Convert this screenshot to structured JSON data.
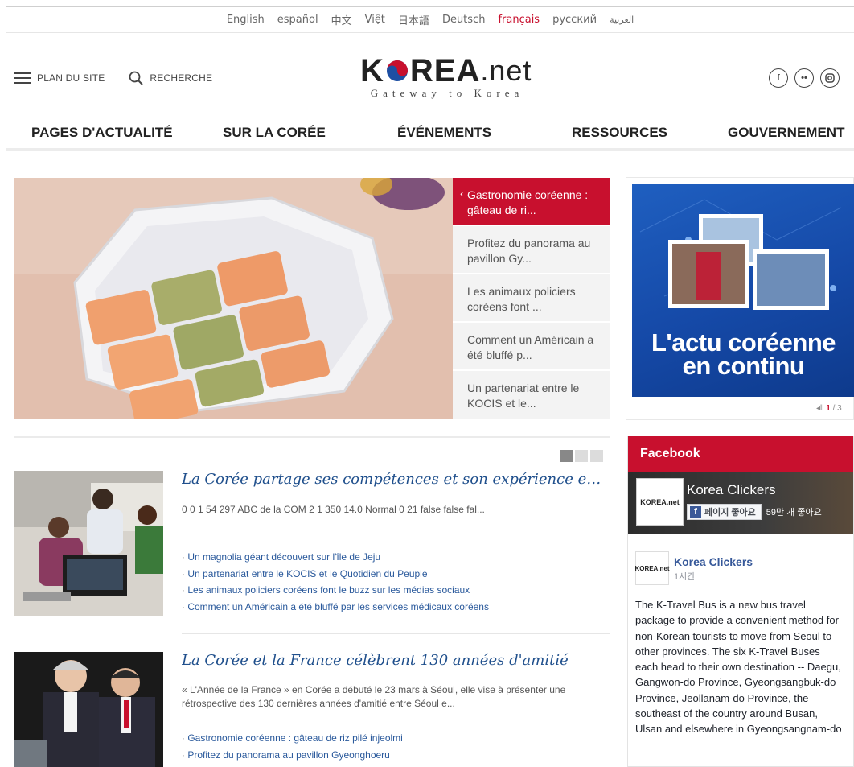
{
  "languages": [
    {
      "label": "English",
      "active": false
    },
    {
      "label": "español",
      "active": false
    },
    {
      "label": "中文",
      "active": false
    },
    {
      "label": "Việt",
      "active": false
    },
    {
      "label": "日本語",
      "active": false
    },
    {
      "label": "Deutsch",
      "active": false
    },
    {
      "label": "français",
      "active": true
    },
    {
      "label": "русский",
      "active": false
    },
    {
      "label": "العربية",
      "active": false
    }
  ],
  "header": {
    "sitemap_label": "PLAN DU SITE",
    "search_label": "RECHERCHE",
    "logo_text_left": "K",
    "logo_text_right": "REA",
    "logo_net": ".net",
    "logo_tagline": "Gateway to Korea",
    "social_icons": [
      "facebook-icon",
      "flickr-icon",
      "instagram-icon"
    ]
  },
  "nav": [
    "PAGES D'ACTUALITÉ",
    "SUR LA CORÉE",
    "ÉVÉNEMENTS",
    "RESSOURCES",
    "GOUVERNEMENT"
  ],
  "slider": {
    "items": [
      {
        "label": "Gastronomie coréenne : gâteau de ri...",
        "active": true
      },
      {
        "label": "Profitez du panorama au pavillon Gy...",
        "active": false
      },
      {
        "label": "Les animaux policiers coréens font ...",
        "active": false
      },
      {
        "label": "Comment un Américain a été bluffé p...",
        "active": false
      },
      {
        "label": "Un partenariat entre le KOCIS et le...",
        "active": false
      }
    ]
  },
  "banner": {
    "title_line1": "L'actu coréenne",
    "title_line2": "en continu",
    "pager_current": "1",
    "pager_rest": " / 3",
    "pager_prefix": "◂ll "
  },
  "articles": [
    {
      "title": "La Corée partage ses compétences et son expérience en ma...",
      "desc": "0 0 1 54 297 ABC de la COM 2 1 350 14.0 Normal 0 21 false false fal...",
      "links": [
        "Un magnolia géant découvert sur l'île de Jeju",
        "Un partenariat entre le KOCIS et le Quotidien du Peuple",
        "Les animaux policiers coréens font le buzz sur les médias sociaux",
        "Comment un Américain a été bluffé par les services médicaux coréens"
      ]
    },
    {
      "title": "La Corée et la France célèbrent 130 années d'amitié",
      "desc": "« L'Année de la France » en Corée a débuté le 23 mars à Séoul, elle vise à présenter une rétrospective des 130 dernières années d'amitié entre Séoul e...",
      "links": [
        "Gastronomie coréenne : gâteau de riz pilé injeolmi",
        "Profitez du panorama au pavillon Gyeonghoeru"
      ]
    }
  ],
  "facebook": {
    "heading": "Facebook",
    "page_name": "Korea Clickers",
    "like_label": "페이지 좋아요",
    "like_count": "59만 개 좋아요",
    "post_name": "Korea Clickers",
    "post_time": "1시간",
    "post_text": "The K-Travel Bus is a new bus travel package to provide a convenient method for non-Korean tourists to move from Seoul to other provinces. The six K-Travel Buses each head to their own destination -- Daegu, Gangwon-do Province, Gyeongsangbuk-do Province, Jeollanam-do Province, the southeast of the country around Busan, Ulsan and elsewhere in Gyeongsangnam-do"
  },
  "colors": {
    "accent": "#c8102e",
    "link": "#2b5a9c",
    "title": "#1f4f8c"
  }
}
